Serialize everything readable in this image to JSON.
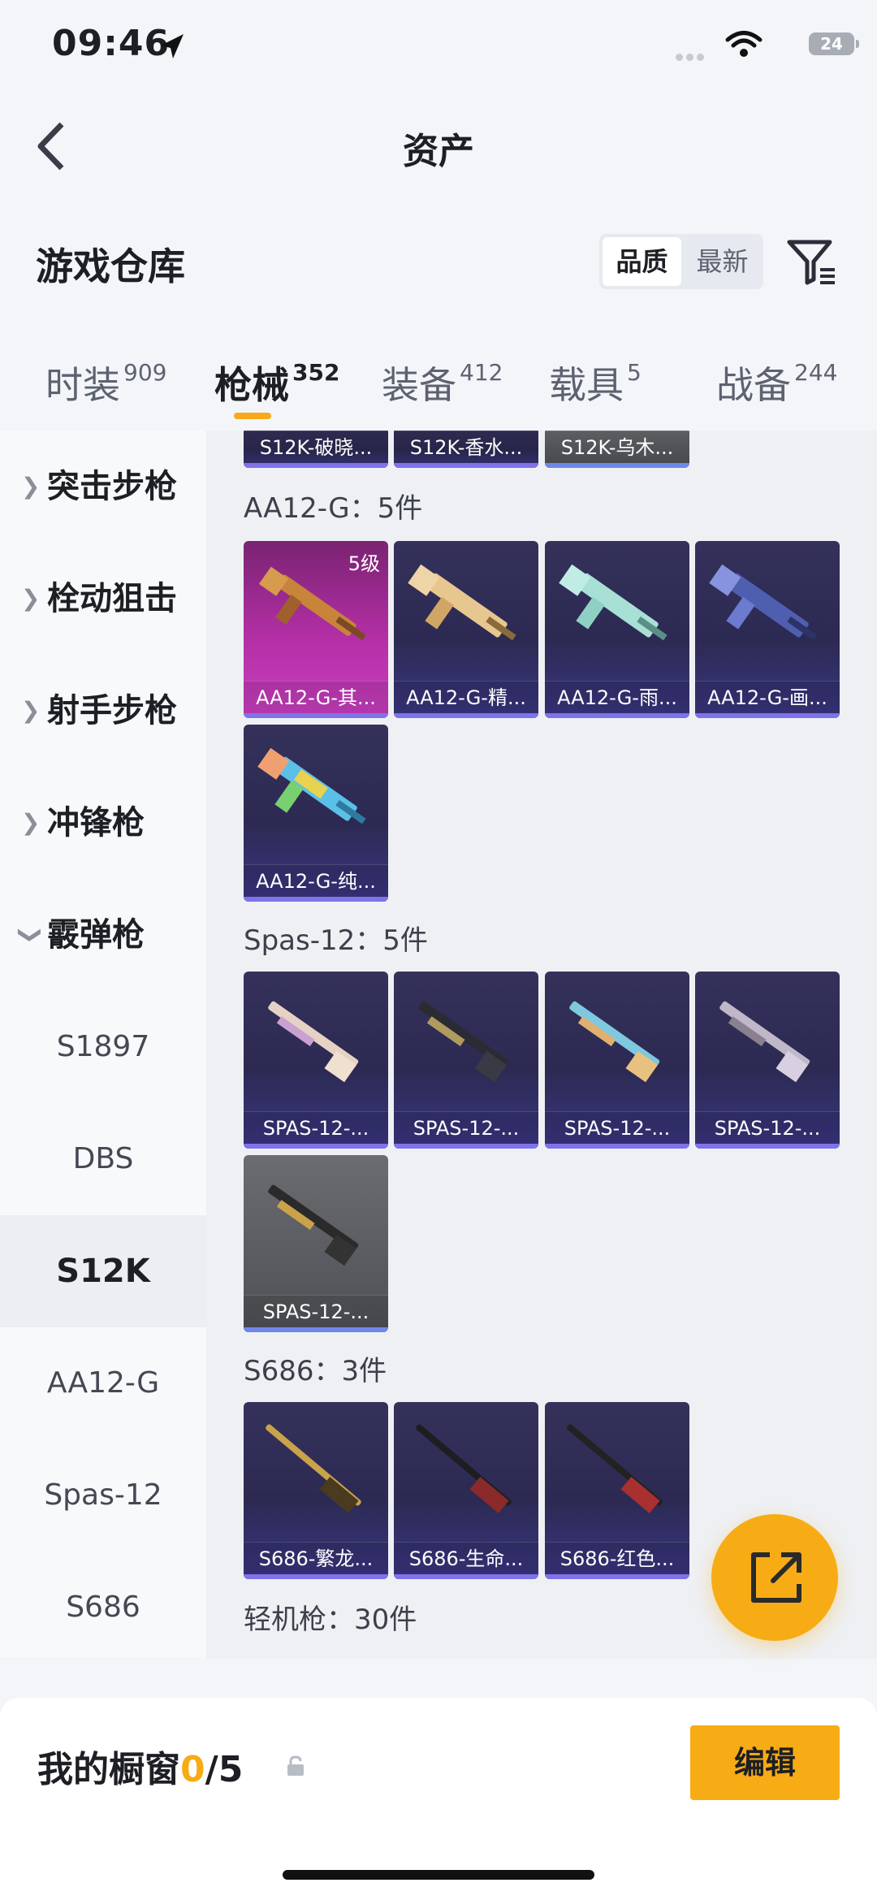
{
  "status_bar": {
    "time": "09:46",
    "battery": "24"
  },
  "header": {
    "title": "资产"
  },
  "section": {
    "title": "游戏仓库",
    "sort_options": [
      "品质",
      "最新"
    ],
    "active_sort": "品质"
  },
  "tabs": [
    {
      "label": "时装",
      "count": "909"
    },
    {
      "label": "枪械",
      "count": "352"
    },
    {
      "label": "装备",
      "count": "412"
    },
    {
      "label": "载具",
      "count": "5"
    },
    {
      "label": "战备",
      "count": "244"
    }
  ],
  "active_tab": "枪械",
  "sidebar": {
    "categories": [
      "突击步枪",
      "栓动狙击",
      "射手步枪",
      "冲锋枪",
      "霰弹枪"
    ],
    "subitems": [
      "S1897",
      "DBS",
      "S12K",
      "AA12-G",
      "Spas-12",
      "S686"
    ],
    "active_sub": "S12K"
  },
  "content": {
    "top_partial_cards": [
      "S12K-破晓...",
      "S12K-香水...",
      "S12K-乌木..."
    ],
    "groups": [
      {
        "label": "AA12-G：5件",
        "cards": [
          {
            "name": "AA12-G-其...",
            "level": "5级"
          },
          {
            "name": "AA12-G-精..."
          },
          {
            "name": "AA12-G-雨..."
          },
          {
            "name": "AA12-G-画..."
          },
          {
            "name": "AA12-G-纯..."
          }
        ]
      },
      {
        "label": "Spas-12：5件",
        "cards": [
          {
            "name": "SPAS-12-..."
          },
          {
            "name": "SPAS-12-..."
          },
          {
            "name": "SPAS-12-..."
          },
          {
            "name": "SPAS-12-..."
          },
          {
            "name": "SPAS-12-..."
          }
        ]
      },
      {
        "label": "S686：3件",
        "cards": [
          {
            "name": "S686-繁龙..."
          },
          {
            "name": "S686-生命..."
          },
          {
            "name": "S686-红色..."
          }
        ]
      },
      {
        "label": "轻机枪：30件",
        "cards": []
      }
    ]
  },
  "bottom": {
    "showcase_label": "我的橱窗",
    "showcase_current": "0",
    "showcase_total": "/5",
    "edit_label": "编辑"
  }
}
